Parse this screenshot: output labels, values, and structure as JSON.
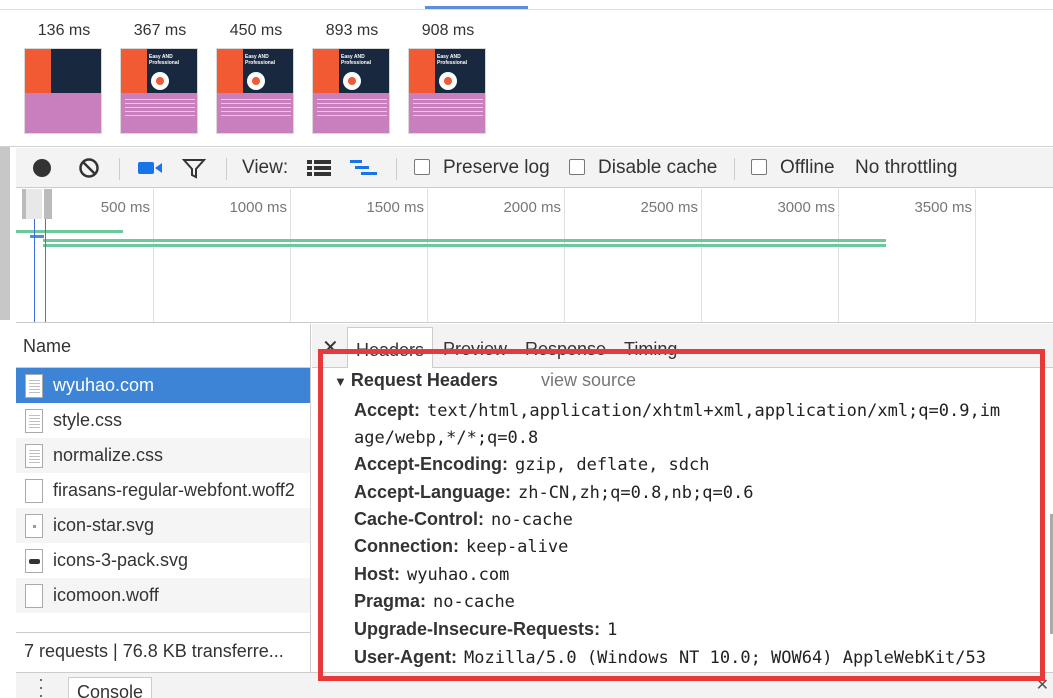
{
  "filmstrip": {
    "frames": [
      {
        "time": "136 ms",
        "title": ""
      },
      {
        "time": "367 ms",
        "title": "Easy AND Professional"
      },
      {
        "time": "450 ms",
        "title": "Easy AND Professional"
      },
      {
        "time": "893 ms",
        "title": "Easy AND Professional"
      },
      {
        "time": "908 ms",
        "title": "Easy AND Professional"
      }
    ]
  },
  "toolbar": {
    "record_icon": "record-icon",
    "clear_icon": "clear-icon",
    "screenshot_icon": "video-camera-icon",
    "filter_icon": "filter-icon",
    "view_label": "View:",
    "preserve_log": "Preserve log",
    "disable_cache": "Disable cache",
    "offline": "Offline",
    "throttling": "No throttling"
  },
  "overview": {
    "ticks": [
      "500 ms",
      "1000 ms",
      "1500 ms",
      "2000 ms",
      "2500 ms",
      "3000 ms",
      "3500 ms"
    ],
    "colors": {
      "bar": "#6ec89b",
      "blue_marker": "#3d6fd6",
      "red_marker": "#d24a4a"
    }
  },
  "requests": {
    "column_name": "Name",
    "items": [
      {
        "name": "wyuhao.com",
        "icon": "document-icon",
        "selected": true
      },
      {
        "name": "style.css",
        "icon": "stylesheet-icon"
      },
      {
        "name": "normalize.css",
        "icon": "stylesheet-icon"
      },
      {
        "name": "firasans-regular-webfont.woff2",
        "icon": "font-file-icon"
      },
      {
        "name": "icon-star.svg",
        "icon": "image-file-icon"
      },
      {
        "name": "icons-3-pack.svg",
        "icon": "image-file-icon"
      },
      {
        "name": "icomoon.woff",
        "icon": "font-file-icon"
      }
    ],
    "summary": "7 requests  |  76.8 KB transferre..."
  },
  "details": {
    "tabs": [
      "Headers",
      "Preview",
      "Response",
      "Timing"
    ],
    "active_tab": "Headers",
    "section_title": "Request Headers",
    "view_source": "view source",
    "headers": [
      {
        "key": "Accept:",
        "value": "text/html,application/xhtml+xml,application/xml;q=0.9,im"
      },
      {
        "key": "",
        "value": "age/webp,*/*;q=0.8"
      },
      {
        "key": "Accept-Encoding:",
        "value": "gzip, deflate, sdch"
      },
      {
        "key": "Accept-Language:",
        "value": "zh-CN,zh;q=0.8,nb;q=0.6"
      },
      {
        "key": "Cache-Control:",
        "value": "no-cache"
      },
      {
        "key": "Connection:",
        "value": "keep-alive"
      },
      {
        "key": "Host:",
        "value": "wyuhao.com"
      },
      {
        "key": "Pragma:",
        "value": "no-cache"
      },
      {
        "key": "Upgrade-Insecure-Requests:",
        "value": "1"
      },
      {
        "key": "User-Agent:",
        "value": "Mozilla/5.0 (Windows NT 10.0; WOW64) AppleWebKit/53"
      }
    ]
  },
  "drawer": {
    "console_tab": "Console"
  },
  "annotation": {
    "color": "#e8393a"
  }
}
